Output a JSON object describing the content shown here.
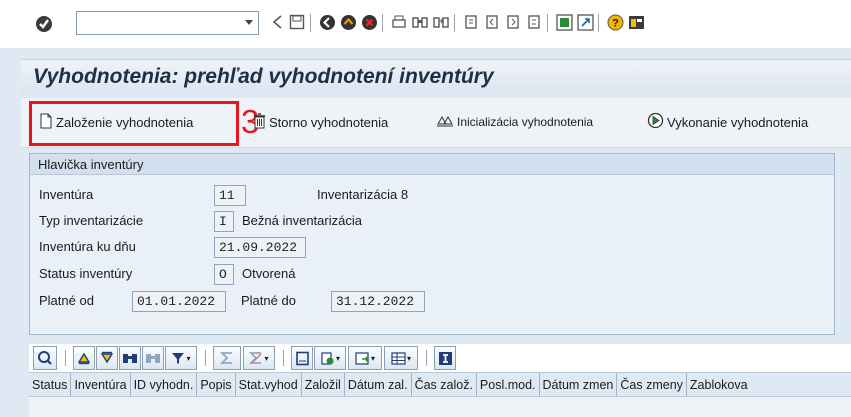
{
  "system_toolbar": {
    "command_field_value": "",
    "icons": [
      "enter-icon",
      "back-icon",
      "save-icon",
      "back-green-icon",
      "exit-icon",
      "cancel-icon",
      "print-icon",
      "find-icon",
      "find-next-icon",
      "first-page-icon",
      "previous-page-icon",
      "next-page-icon",
      "last-page-icon",
      "new-session-icon",
      "shortcut-icon",
      "help-icon",
      "layout-icon"
    ]
  },
  "title": "Vyhodnotenia: prehľad vyhodnotení inventúry",
  "app_toolbar": {
    "create_label": "Založenie vyhodnotenia",
    "cancel_label": "Storno vyhodnotenia",
    "init_label": "Inicializácia vyhodnotenia",
    "execute_label": "Vykonanie vyhodnotenia",
    "step_number": "3"
  },
  "header_group": {
    "title": "Hlavička inventúry",
    "inventory_label": "Inventúra",
    "inventory_value": "11",
    "inventory_desc": "Inventarizácia 8",
    "type_label": "Typ inventarizácie",
    "type_value": "I",
    "type_desc": "Bežná inventarizácia",
    "keydate_label": "Inventúra ku dňu",
    "keydate_value": "21.09.2022",
    "status_label": "Status inventúry",
    "status_value": "O",
    "status_desc": "Otvorená",
    "valid_from_label": "Platné od",
    "valid_from_value": "01.01.2022",
    "valid_to_label": "Platné do",
    "valid_to_value": "31.12.2022"
  },
  "grid": {
    "columns": [
      "Status",
      "Inventúra",
      "ID vyhodn.",
      "Popis",
      "Stat.vyhod",
      "Založil",
      "Dátum zal.",
      "Čas založ.",
      "Posl.mod.",
      "Dátum zmen",
      "Čas zmeny",
      "Zablokova"
    ]
  },
  "colors": {
    "accent_red": "#e8131b",
    "title_text": "#1d3045",
    "background": "#dfe9f4"
  }
}
